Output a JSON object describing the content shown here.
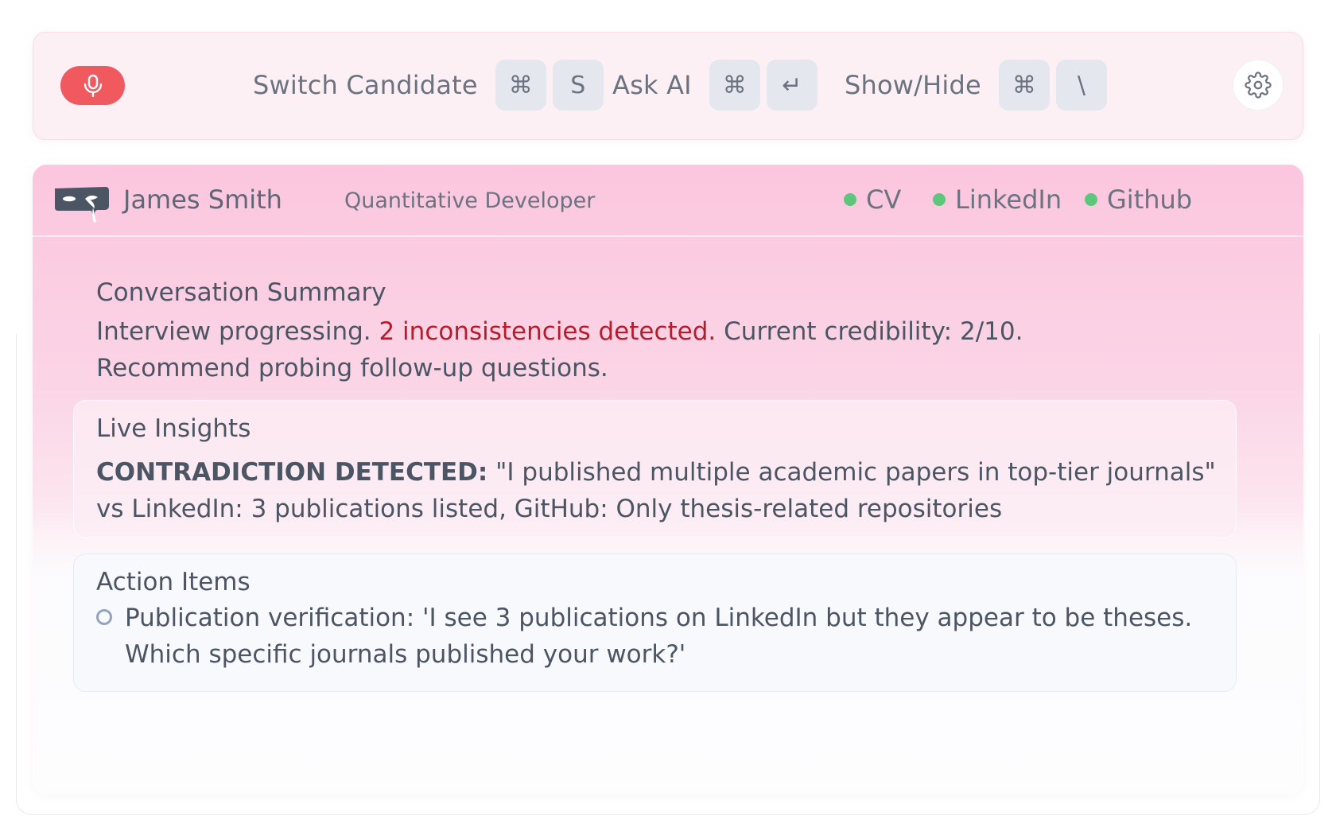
{
  "toolbar": {
    "mic_icon": "microphone-icon",
    "mic_color": "#f05a5f",
    "shortcuts": [
      {
        "label": "Switch Candidate",
        "keys": [
          "⌘",
          "S"
        ]
      },
      {
        "label": "Ask AI",
        "keys": [
          "⌘",
          "↵"
        ]
      },
      {
        "label": "Show/Hide",
        "keys": [
          "⌘",
          "\\"
        ]
      }
    ],
    "settings_icon": "gear-icon"
  },
  "candidate": {
    "name": "James Smith",
    "role": "Quantitative Developer",
    "sources": [
      {
        "label": "CV",
        "status_color": "#5cc77a"
      },
      {
        "label": "LinkedIn",
        "status_color": "#5cc77a"
      },
      {
        "label": "Github",
        "status_color": "#5cc77a"
      }
    ]
  },
  "summary": {
    "title": "Conversation Summary",
    "text_before": "Interview progressing. ",
    "alert": "2 inconsistencies detected.",
    "text_after": " Current credibility: 2/10.",
    "line2": "Recommend probing follow-up questions.",
    "alert_color": "#b51c2c"
  },
  "insights": {
    "title": "Live Insights",
    "label": "CONTRADICTION DETECTED:",
    "quote": " \"I published multiple academic papers in top-tier journals\"",
    "detail": "vs LinkedIn: 3 publications listed, GitHub: Only thesis-related repositories"
  },
  "actions": {
    "title": "Action Items",
    "items": [
      {
        "line1": "Publication verification: 'I see 3 publications on LinkedIn but they appear to be theses.",
        "line2": "Which specific journals published your work?'"
      }
    ]
  }
}
